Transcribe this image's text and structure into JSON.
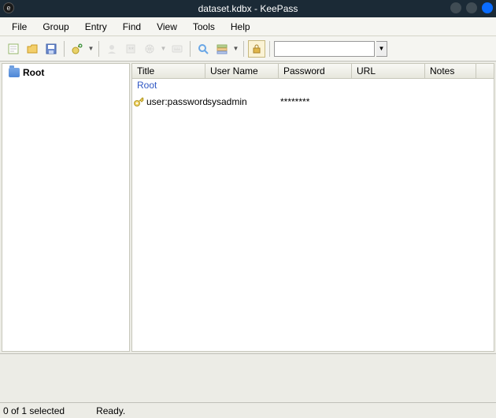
{
  "title": "dataset.kdbx - KeePass",
  "menu": {
    "file": "File",
    "group": "Group",
    "entry": "Entry",
    "find": "Find",
    "view": "View",
    "tools": "Tools",
    "help": "Help"
  },
  "search": {
    "value": "",
    "placeholder": ""
  },
  "tree": {
    "root": "Root"
  },
  "columns": {
    "title": "Title",
    "user": "User Name",
    "password": "Password",
    "url": "URL",
    "notes": "Notes"
  },
  "groupHeader": "Root",
  "entries": [
    {
      "title": "user:password",
      "user": "sysadmin",
      "password": "********",
      "url": "",
      "notes": ""
    }
  ],
  "status": {
    "selection": "0 of 1 selected",
    "state": "Ready."
  },
  "colWidths": {
    "title": 93,
    "user": 93,
    "password": 93,
    "url": 93,
    "notes": 65,
    "last": 15
  }
}
